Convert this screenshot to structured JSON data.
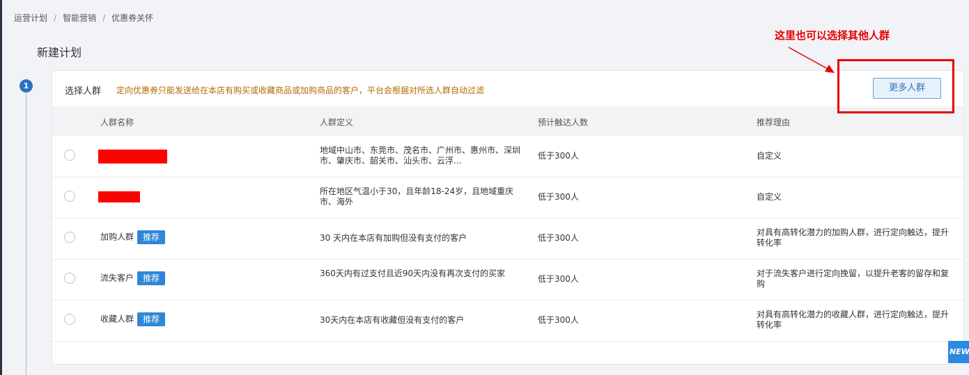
{
  "breadcrumb": {
    "items": [
      "运营计划",
      "智能营销",
      "优惠券关怀"
    ],
    "separator": "/"
  },
  "page_title": "新建计划",
  "step": {
    "number": "1"
  },
  "section": {
    "title": "选择人群",
    "note": "定向优惠券只能发送给在本店有购买或收藏商品或加购商品的客户，平台会根据对所选人群自动过滤",
    "more_button": "更多人群"
  },
  "table": {
    "headers": [
      "人群名称",
      "人群定义",
      "预计触达人数",
      "推荐理由"
    ],
    "rows": [
      {
        "name": "",
        "redacted": true,
        "tag": "",
        "definition": "地域中山市、东莞市、茂名市、广州市、惠州市、深圳市、肇庆市、韶关市、汕头市、云浮...",
        "reach": "低于300人",
        "reason": "自定义"
      },
      {
        "name": "",
        "redacted": true,
        "tag": "",
        "definition": "所在地区气温小于30，且年龄18-24岁，且地域重庆市、海外",
        "reach": "低于300人",
        "reason": "自定义"
      },
      {
        "name": "加购人群",
        "redacted": false,
        "tag": "推荐",
        "definition": "30 天内在本店有加购但没有支付的客户",
        "reach": "低于300人",
        "reason": "对具有高转化潜力的加购人群，进行定向触达，提升转化率"
      },
      {
        "name": "流失客户",
        "redacted": false,
        "tag": "推荐",
        "definition": "360天内有过支付且近90天内没有再次支付的买家",
        "reach": "低于300人",
        "reason": "对于流失客户进行定向挽留，以提升老客的留存和复购"
      },
      {
        "name": "收藏人群",
        "redacted": false,
        "tag": "推荐",
        "definition": "30天内在本店有收藏但没有支付的客户",
        "reach": "低于300人",
        "reason": "对具有高转化潜力的收藏人群，进行定向触达，提升转化率"
      }
    ]
  },
  "annotation": {
    "text": "这里也可以选择其他人群",
    "color": "#e60000"
  },
  "new_badge": "NEW",
  "colors": {
    "accent": "#2f87d8",
    "note": "#b36b00",
    "redaction": "#ff0000"
  }
}
